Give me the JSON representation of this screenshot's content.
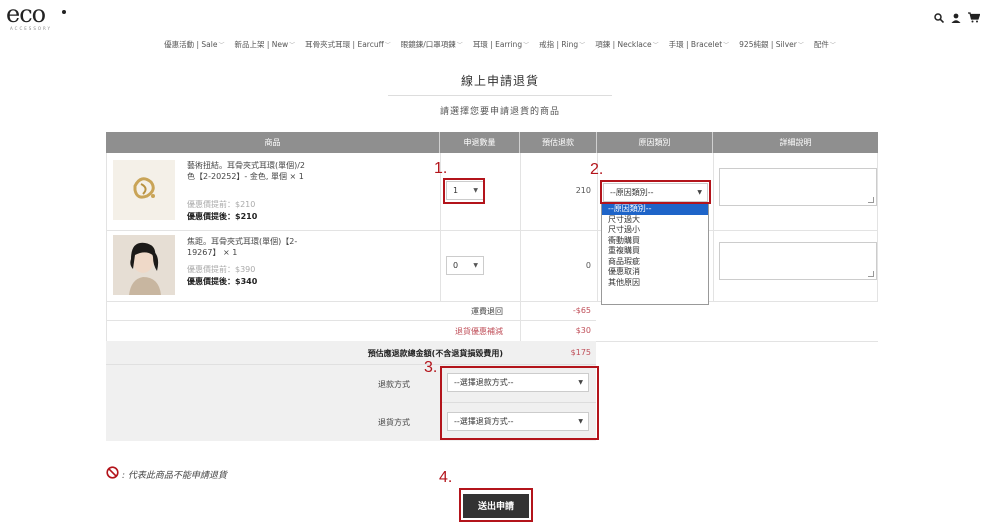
{
  "header": {
    "logo": "eco",
    "logo_sub": "ACCESSORY",
    "nav": [
      "優惠活動 | Sale",
      "新品上架 | New",
      "耳骨夾式耳環 | Earcuff",
      "眼鏡鍊/口罩項鍊",
      "耳環 | Earring",
      "戒指 | Ring",
      "項鍊 | Necklace",
      "手環 | Bracelet",
      "925純銀 | Silver",
      "配件"
    ]
  },
  "page": {
    "title": "線上申請退貨",
    "subtitle": "請選擇您要申請退貨的商品"
  },
  "table": {
    "headers": [
      "商品",
      "申退數量",
      "預估退款",
      "原因類別",
      "詳細說明"
    ],
    "rows": [
      {
        "name": "藝術扭結。耳骨夾式耳環(單個)/2色【2-20252】- 金色, 單個 × 1",
        "before_label": "優惠價提前：",
        "before_price": "$210",
        "after_label": "優惠價提後：",
        "after_price": "$210",
        "qty": "1",
        "refund": "210",
        "reason": "--原因類別--"
      },
      {
        "name": "焦距。耳骨夾式耳環(單個)【2-19267】 × 1",
        "before_label": "優惠價提前：",
        "before_price": "$390",
        "after_label": "優惠價提後：",
        "after_price": "$340",
        "qty": "0",
        "refund": "0"
      }
    ],
    "summary": [
      {
        "label": "運費退回",
        "value": "-$65"
      },
      {
        "label": "退貨優惠補減",
        "value": "$30"
      },
      {
        "label": "預估應退款總金額(不含退貨損毀費用)",
        "value": "$175"
      }
    ]
  },
  "reason_options": [
    "--原因類別--",
    "尺寸過大",
    "尺寸過小",
    "衝動購買",
    "重複購買",
    "商品瑕疵",
    "優惠取消",
    "其他原因"
  ],
  "refund": {
    "label": "退款方式",
    "value": "--選擇退款方式--"
  },
  "return": {
    "label": "退貨方式",
    "value": "--選擇退貨方式--"
  },
  "steps": [
    "1.",
    "2.",
    "3.",
    "4."
  ],
  "note": ": 代表此商品不能申請退貨",
  "submit_label": "送出申請",
  "colors": {
    "accent": "#b3141b",
    "header_bg": "#8f8f8f",
    "red_text": "#c0505a"
  }
}
